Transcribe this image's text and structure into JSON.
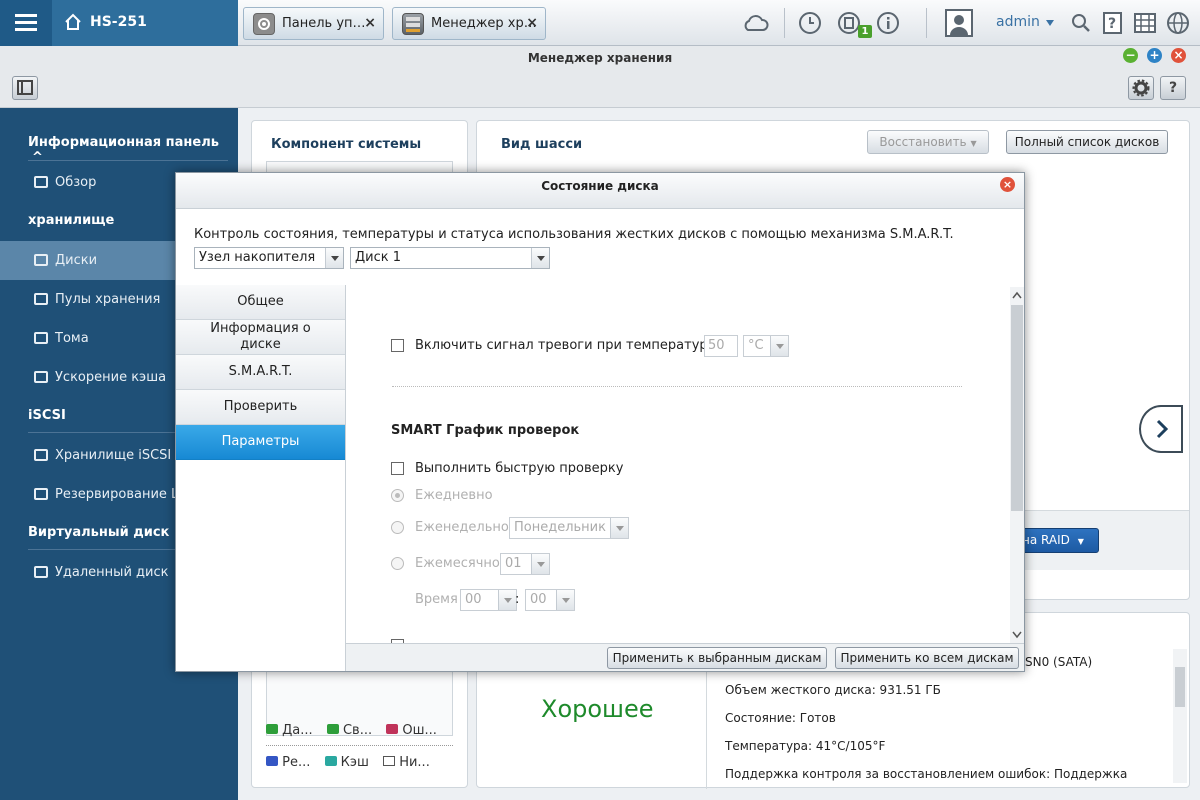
{
  "topbar": {
    "device_name": "HS-251",
    "tabs": [
      {
        "label": "Панель уп…",
        "close": "×"
      },
      {
        "label": "Менеджер хр…",
        "close": "×"
      }
    ],
    "notification_count": "1",
    "user": "admin"
  },
  "window": {
    "title": "Менеджер хранения",
    "controls": {
      "minimize": "−",
      "maximize": "+",
      "close": "×"
    },
    "help": "?"
  },
  "sidebar": {
    "sections": [
      {
        "label": "Информационная панель",
        "chevron": "^"
      },
      {
        "label": "хранилище"
      },
      {
        "label": "iSCSI"
      },
      {
        "label": "Виртуальный диск"
      }
    ],
    "items": [
      {
        "label": "Обзор"
      },
      {
        "label": "Диски"
      },
      {
        "label": "Пулы хранения"
      },
      {
        "label": "Тома"
      },
      {
        "label": "Ускорение кэша"
      },
      {
        "label": "Хранилище iSCSI"
      },
      {
        "label": "Резервирование L"
      },
      {
        "label": "Удаленный диск"
      }
    ]
  },
  "background": {
    "system_component_title": "Компонент системы",
    "chassis_title": "Вид шасси",
    "restore_button": "Восстановить",
    "full_disk_list_button": "Полный список дисков",
    "raid_button": "на RAID",
    "disk_id_fragment": "SN0 (SATA)",
    "health_status": "Хорошее",
    "disk_info": [
      "Объем жесткого диска: 931.51 ГБ",
      "Состояние: Готов",
      "Температура: 41°C/105°F",
      "Поддержка контроля за восстановлением ошибок: Поддержка"
    ],
    "legend": [
      "Да...",
      "Св...",
      "Ош...",
      "Ре...",
      "Кэш",
      "Ни..."
    ]
  },
  "modal": {
    "title": "Состояние диска",
    "close": "×",
    "description": "Контроль состояния, температуры и статуса использования жестких дисков с помощью механизма S.M.A.R.T.",
    "node_select": "Узел накопителя",
    "disk_select": "Диск 1",
    "nav": [
      {
        "label": "Общее"
      },
      {
        "label": "Информация о диске"
      },
      {
        "label": "S.M.A.R.T."
      },
      {
        "label": "Проверить"
      },
      {
        "label": "Параметры"
      }
    ],
    "alarm_label": "Включить сигнал тревоги при температуре",
    "alarm_value": "50",
    "temp_unit": "°C",
    "schedule_title": "SMART График проверок",
    "quick_test_label": "Выполнить быструю проверку",
    "daily": "Ежедневно",
    "weekly": "Еженедельно",
    "weekday": "Понедельник",
    "monthly": "Ежемесячно",
    "month_day": "01",
    "time_label": "Время",
    "hour": "00",
    "minute": "00",
    "time_sep": ":",
    "apply_selected": "Применить к выбранным дискам",
    "apply_all": "Применить ко всем дискам"
  }
}
